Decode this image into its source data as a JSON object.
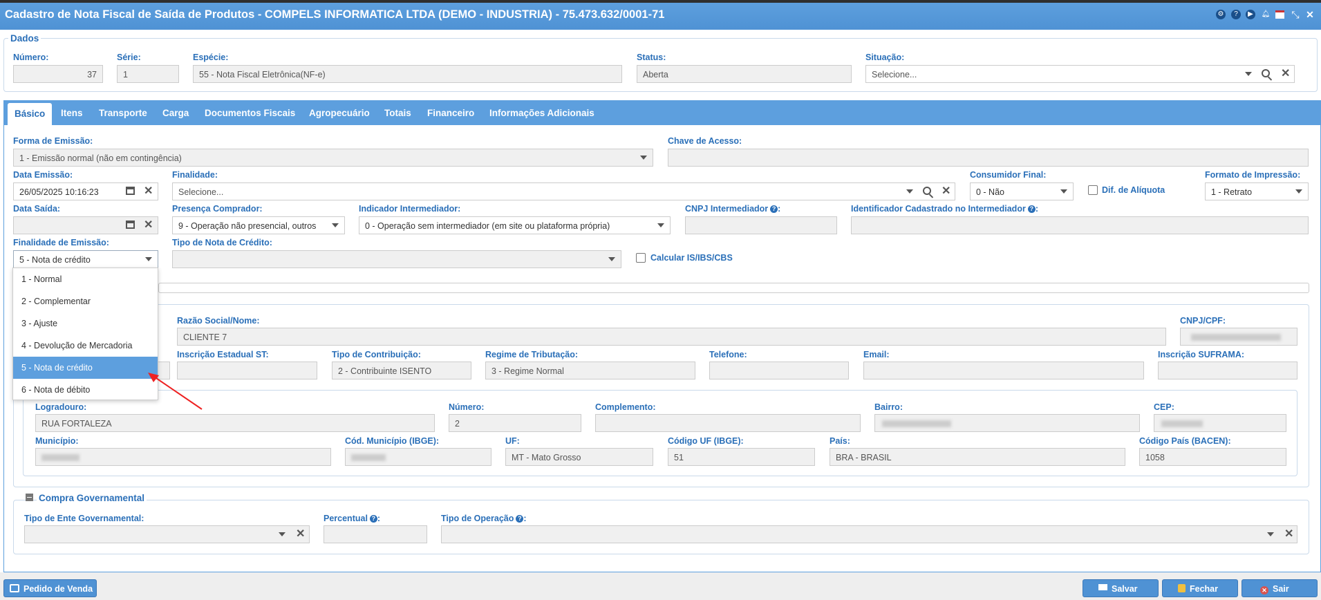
{
  "window": {
    "title": "Cadastro de Nota Fiscal de Saída de Produtos - COMPELS INFORMATICA LTDA (DEMO - INDUSTRIA) - 75.473.632/0001-71"
  },
  "dados": {
    "legend": "Dados",
    "numero_label": "Número:",
    "numero_value": "37",
    "serie_label": "Série:",
    "serie_value": "1",
    "especie_label": "Espécie:",
    "especie_value": "55 - Nota Fiscal Eletrônica(NF-e)",
    "status_label": "Status:",
    "status_value": "Aberta",
    "situacao_label": "Situação:",
    "situacao_placeholder": "Selecione..."
  },
  "tabs": [
    "Básico",
    "Itens",
    "Transporte",
    "Carga",
    "Documentos Fiscais",
    "Agropecuário",
    "Totais",
    "Financeiro",
    "Informações Adicionais"
  ],
  "basico": {
    "forma_emissao_label": "Forma de Emissão:",
    "forma_emissao_value": "1 - Emissão normal (não em contingência)",
    "chave_acesso_label": "Chave de Acesso:",
    "data_emissao_label": "Data Emissão:",
    "data_emissao_value": "26/05/2025 10:16:23",
    "finalidade_label": "Finalidade:",
    "finalidade_placeholder": "Selecione...",
    "consumidor_final_label": "Consumidor Final:",
    "consumidor_final_value": "0 - Não",
    "dif_aliquota_label": "Dif. de Alíquota",
    "formato_impressao_label": "Formato de Impressão:",
    "formato_impressao_value": "1 - Retrato",
    "data_saida_label": "Data Saída:",
    "presenca_label": "Presença Comprador:",
    "presenca_value": "9 - Operação não presencial, outros",
    "indicador_label": "Indicador Intermediador:",
    "indicador_value": "0 - Operação sem intermediador (em site ou plataforma própria)",
    "cnpj_intermediador_label": "CNPJ Intermediador",
    "identificador_label": "Identificador Cadastrado no Intermediador",
    "finalidade_emissao_label": "Finalidade de Emissão:",
    "finalidade_emissao_value": "5 - Nota de crédito",
    "tipo_nota_credito_label": "Tipo de Nota de Crédito:",
    "calcular_label": "Calcular IS/IBS/CBS"
  },
  "dropdown": {
    "options": [
      "1 - Normal",
      "2 - Complementar",
      "3 - Ajuste",
      "4 - Devolução de Mercadoria",
      "5 - Nota de crédito",
      "6 - Nota de débito"
    ],
    "selected": "5 - Nota de crédito"
  },
  "destinatario": {
    "razao_label": "Razão Social/Nome:",
    "razao_value": "CLIENTE 7",
    "cnpj_label": "CNPJ/CPF:",
    "ie_st_label": "Inscrição Estadual ST:",
    "tipo_contrib_label": "Tipo de Contribuição:",
    "tipo_contrib_value": "2 - Contribuinte ISENTO",
    "regime_label": "Regime de Tributação:",
    "regime_value": "3 - Regime Normal",
    "telefone_label": "Telefone:",
    "email_label": "Email:",
    "suframa_label": "Inscrição SUFRAMA:"
  },
  "endereco": {
    "logradouro_label": "Logradouro:",
    "logradouro_value": "RUA FORTALEZA",
    "numero_label": "Número:",
    "numero_value": "2",
    "complemento_label": "Complemento:",
    "bairro_label": "Bairro:",
    "cep_label": "CEP:",
    "municipio_label": "Município:",
    "cod_municipio_label": "Cód. Município (IBGE):",
    "uf_label": "UF:",
    "uf_value": "MT - Mato Grosso",
    "cod_uf_label": "Código UF (IBGE):",
    "cod_uf_value": "51",
    "pais_label": "País:",
    "pais_value": "BRA - BRASIL",
    "cod_pais_label": "Código País (BACEN):",
    "cod_pais_value": "1058"
  },
  "compra_gov": {
    "legend": "Compra Governamental",
    "tipo_ente_label": "Tipo de Ente Governamental:",
    "percentual_label": "Percentual",
    "tipo_operacao_label": "Tipo de Operação"
  },
  "footer": {
    "pedido_venda": "Pedido de Venda",
    "salvar": "Salvar",
    "fechar": "Fechar",
    "sair": "Sair"
  },
  "colors": {
    "accent": "#4f92d4",
    "label": "#2a6fb8",
    "sair": "#d9534f"
  }
}
